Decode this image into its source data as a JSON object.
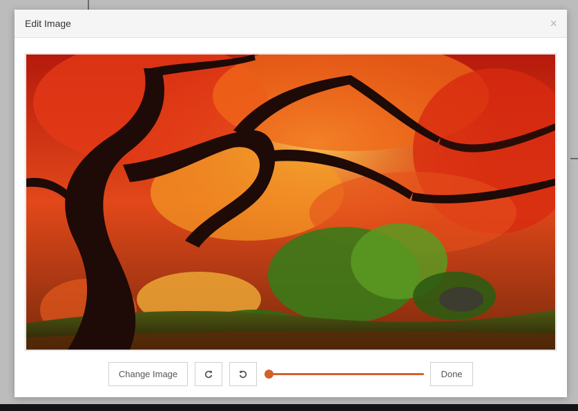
{
  "dialog": {
    "title": "Edit Image",
    "close_symbol": "×"
  },
  "image": {
    "subject": "autumn-japanese-maple-tree",
    "colors": {
      "foliage_red": "#d8301a",
      "foliage_orange": "#f07a18",
      "foliage_yellow": "#f8c030",
      "trunk": "#1e0a06",
      "green": "#3c7a1c",
      "ground": "#3a2a0a"
    }
  },
  "toolbar": {
    "change_image_label": "Change Image",
    "rotate_right_icon": "rotate-clockwise-icon",
    "rotate_left_icon": "rotate-counterclockwise-icon",
    "zoom_slider_value": 0,
    "done_label": "Done"
  },
  "colors": {
    "accent": "#d3602a",
    "header_bg": "#f5f5f5",
    "button_border": "#cfcfcf"
  }
}
